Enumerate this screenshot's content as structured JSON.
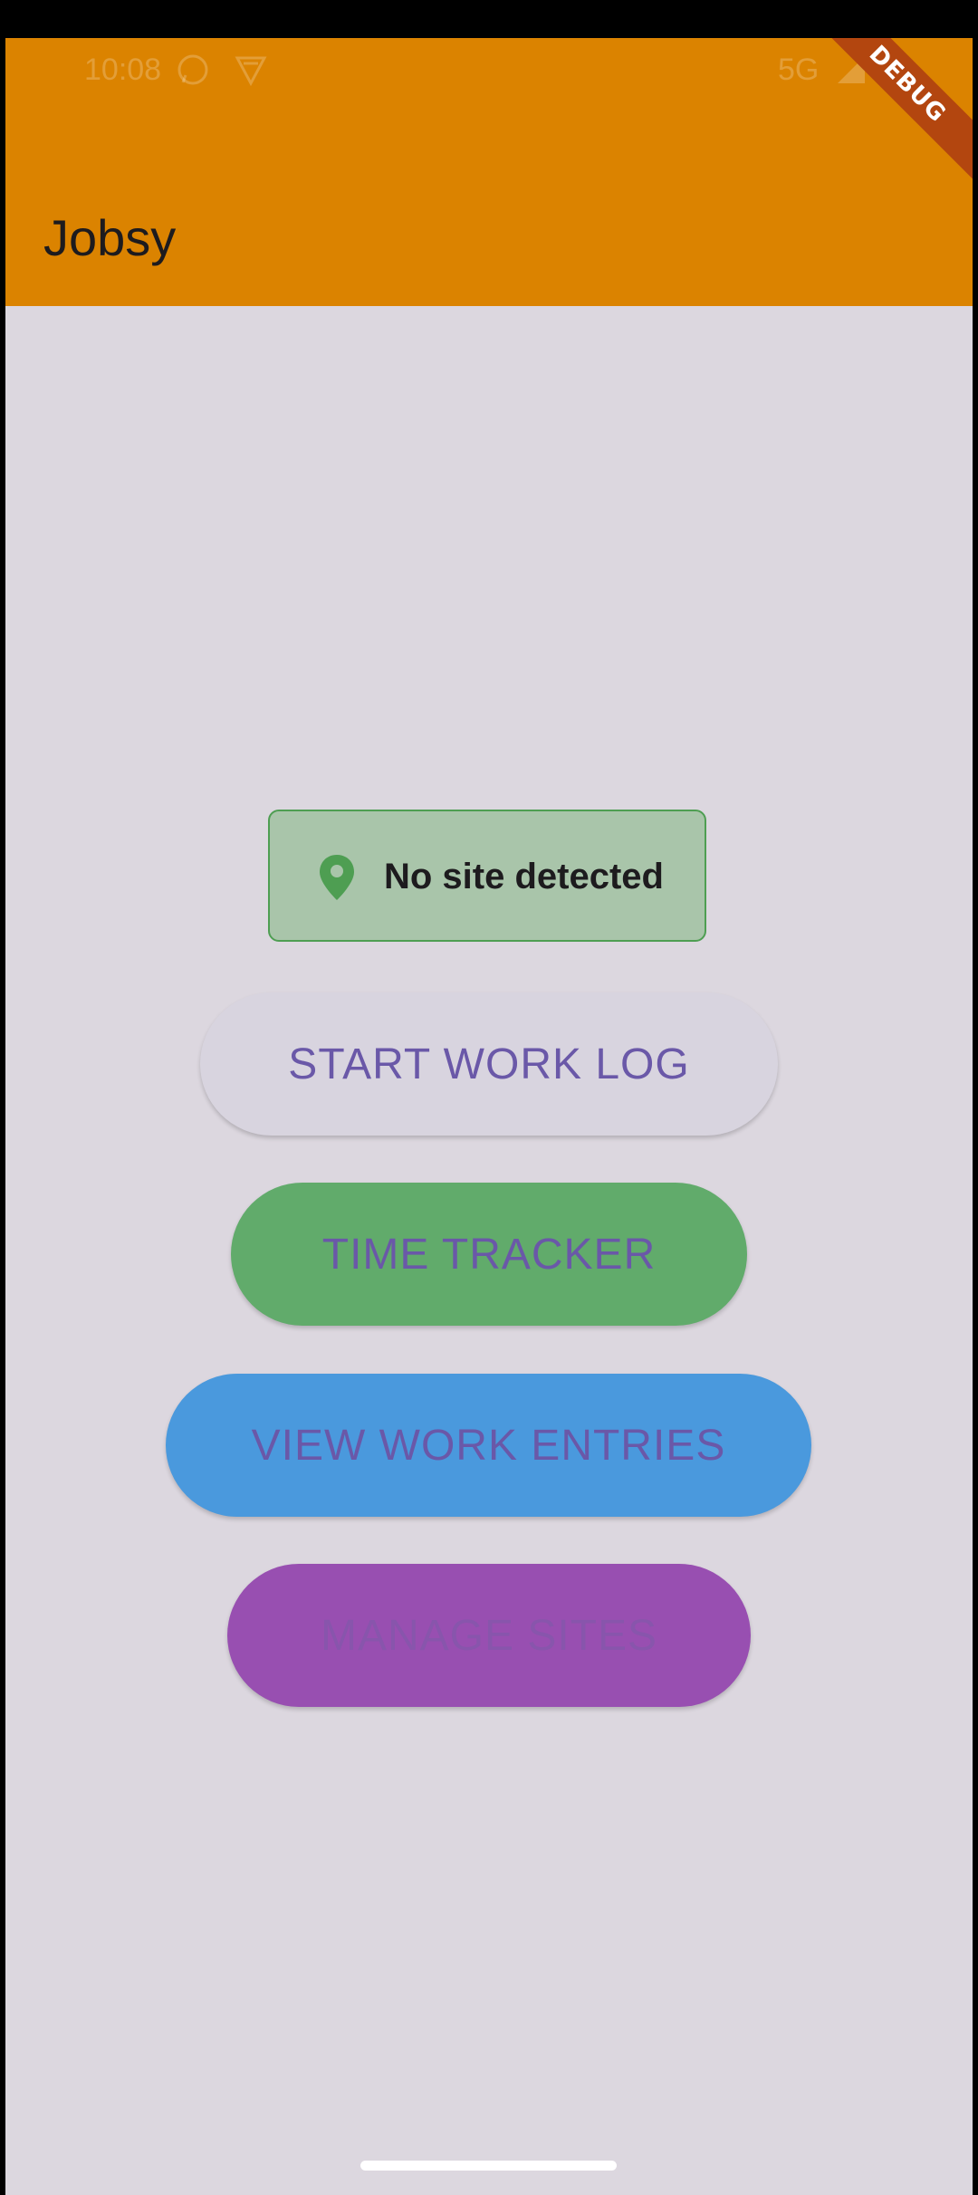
{
  "status_bar": {
    "time": "10:08",
    "network": "5G",
    "icons": [
      "whatsapp-icon",
      "vpn-shield-icon",
      "signal-icon",
      "battery-icon"
    ]
  },
  "app_bar": {
    "title": "Jobsy",
    "color": "#db8300"
  },
  "debug_banner": {
    "label": "DEBUG"
  },
  "site_status": {
    "icon": "location-pin-icon",
    "text": "No site detected",
    "color": "#4e9e52"
  },
  "buttons": {
    "start_work_log": "START WORK LOG",
    "time_tracker": "TIME TRACKER",
    "view_work_entries": "VIEW WORK ENTRIES",
    "manage_sites": "MANAGE SITES"
  },
  "colors": {
    "background": "#dcd7df",
    "button_text": "#6a58a8",
    "time_tracker_bg": "#61ab6b",
    "view_entries_bg": "#4a99dd",
    "manage_sites_bg": "#984fb1"
  }
}
